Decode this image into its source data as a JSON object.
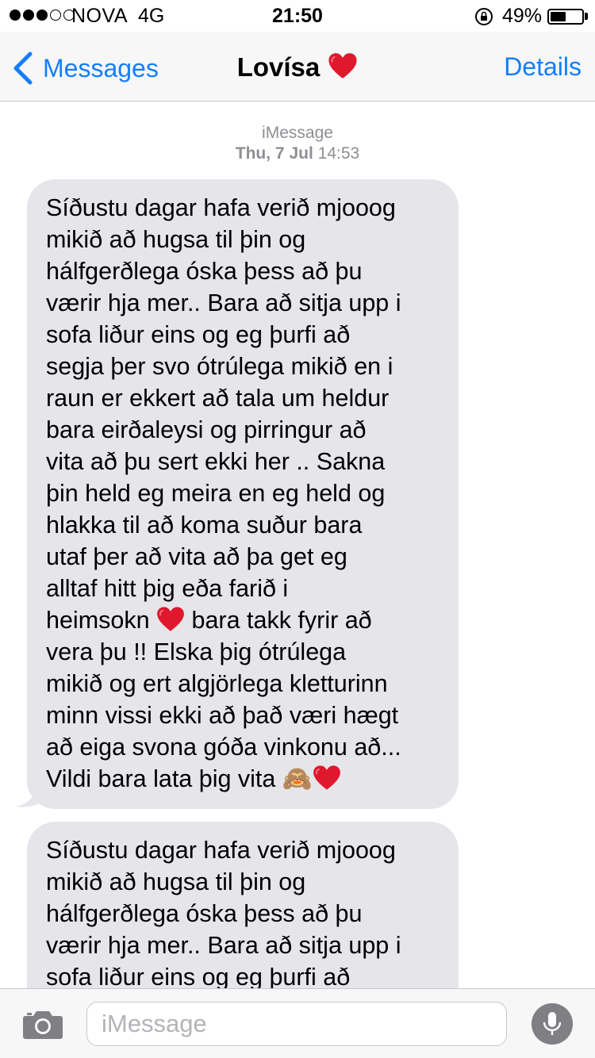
{
  "status_bar": {
    "carrier": "NOVA",
    "network": "4G",
    "time": "21:50",
    "battery_percent": "49%",
    "battery_level": 0.49,
    "signal_bars_filled": 3,
    "signal_bars_total": 5
  },
  "nav": {
    "back_label": "Messages",
    "title": "Lovísa",
    "details_label": "Details",
    "accent_color": "#147efb"
  },
  "thread": {
    "service": "iMessage",
    "date": "Thu, 7 Jul",
    "time": "14:53",
    "messages": [
      {
        "before_heart": "Síðustu dagar hafa verið mjooog\nmikið að hugsa til þin og\nhálfgerðlega óska þess að þu\nværir hja mer.. Bara að sitja upp i\nsofa liður eins og eg þurfi að\nsegja þer svo ótrúlega mikið en i\nraun er ekkert að tala um heldur\nbara eirðaleysi og pirringur að\nvita að þu sert ekki her .. Sakna\nþin held eg meira en eg held og\nhlakka til að koma suður bara\nutaf þer að vita að þa get eg\nalltaf hitt þig eða farið i\nheimsokn",
        "after_heart": " bara takk fyrir að\nvera þu !! Elska þig ótrúlega\nmikið og ert algjörlega kletturinn\nminn vissi ekki að það væri hægt\nað eiga svona góða vinkonu að...\nVildi bara lata þig vita",
        "emoji_end": "🙈"
      },
      {
        "text": "Síðustu dagar hafa verið mjooog\nmikið að hugsa til þin og\nhálfgerðlega óska þess að þu\nværir hja mer.. Bara að sitja upp i\nsofa liður eins og eg þurfi að"
      }
    ]
  },
  "composer": {
    "placeholder": "iMessage"
  },
  "colors": {
    "bubble_received": "#e5e5ea",
    "heart": "#e0182d",
    "meta_text": "#8e8e93"
  }
}
